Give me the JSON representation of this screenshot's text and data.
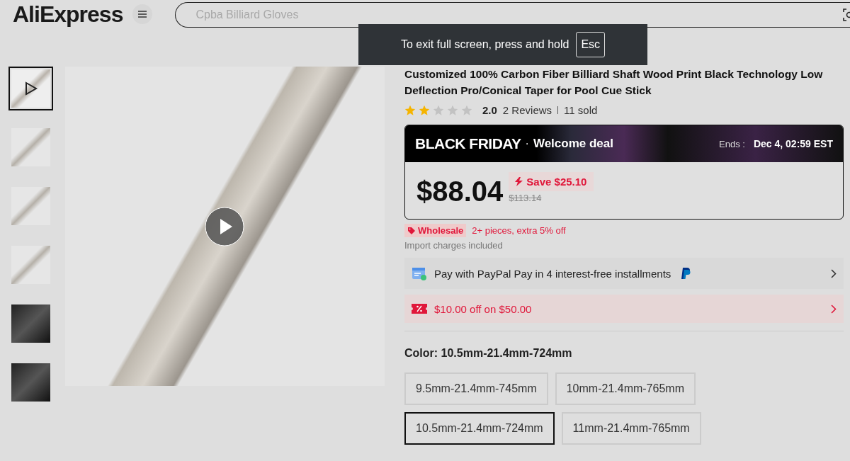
{
  "header": {
    "logo": "AliExpress",
    "search": {
      "placeholder": "Cpba Billiard Gloves"
    }
  },
  "toast": {
    "text": "To exit full screen, press and hold",
    "key": "Esc"
  },
  "gallery": {
    "thumbnails": [
      {
        "kind": "video",
        "selected": true
      },
      {
        "kind": "image",
        "selected": false
      },
      {
        "kind": "image",
        "selected": false
      },
      {
        "kind": "image",
        "selected": false
      },
      {
        "kind": "dark",
        "selected": false
      },
      {
        "kind": "dark",
        "selected": false
      }
    ]
  },
  "product": {
    "title": "Customized 100% Carbon Fiber Billiard Shaft Wood Print Black Technology Low Deflection Pro/Conical Taper for Pool Cue Stick",
    "rating": {
      "stars": 2,
      "score": "2.0",
      "reviews": "2 Reviews",
      "sold": "11 sold"
    },
    "deal": {
      "event": "BLACK FRIDAY",
      "separator": "·",
      "name": "Welcome deal",
      "ends_label": "Ends :",
      "ends_value": "Dec 4, 02:59 EST",
      "price": "$88.04",
      "save": "Save $25.10",
      "original_price": "$113.14"
    },
    "wholesale": {
      "badge": "Wholesale",
      "text": "2+ pieces, extra 5% off"
    },
    "import_note": "Import charges included",
    "offers": [
      {
        "kind": "paypal",
        "text": "Pay with PayPal Pay in 4 interest-free installments"
      },
      {
        "kind": "coupon",
        "text": "$10.00 off on $50.00"
      }
    ],
    "color": {
      "label": "Color:",
      "value": "10.5mm-21.4mm-724mm",
      "options": [
        {
          "label": "9.5mm-21.4mm-745mm",
          "selected": false
        },
        {
          "label": "10mm-21.4mm-765mm",
          "selected": false
        },
        {
          "label": "10.5mm-21.4mm-724mm",
          "selected": true
        },
        {
          "label": "11mm-21.4mm-765mm",
          "selected": false
        }
      ]
    }
  }
}
